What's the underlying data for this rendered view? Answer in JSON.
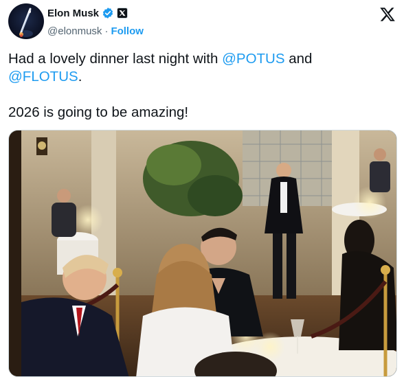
{
  "author": {
    "display_name": "Elon Musk",
    "handle": "@elonmusk",
    "separator": "·",
    "follow_label": "Follow",
    "verified_icon": "verified-badge-icon",
    "affiliate_icon": "x-affiliate-badge-icon"
  },
  "brand": {
    "logo_icon": "x-logo-icon"
  },
  "tweet": {
    "line1_prefix": "Had a lovely dinner last night with ",
    "mention1": "@POTUS",
    "line1_suffix": " and",
    "mention2": "@FLOTUS",
    "line2_suffix": ".",
    "line3": "2026 is going to be amazing!"
  },
  "media": {
    "type": "photo",
    "icon": "photo-dinner"
  },
  "colors": {
    "link": "#1d9bf0",
    "text": "#0f1419",
    "muted": "#536471",
    "verified": "#1d9bf0"
  }
}
